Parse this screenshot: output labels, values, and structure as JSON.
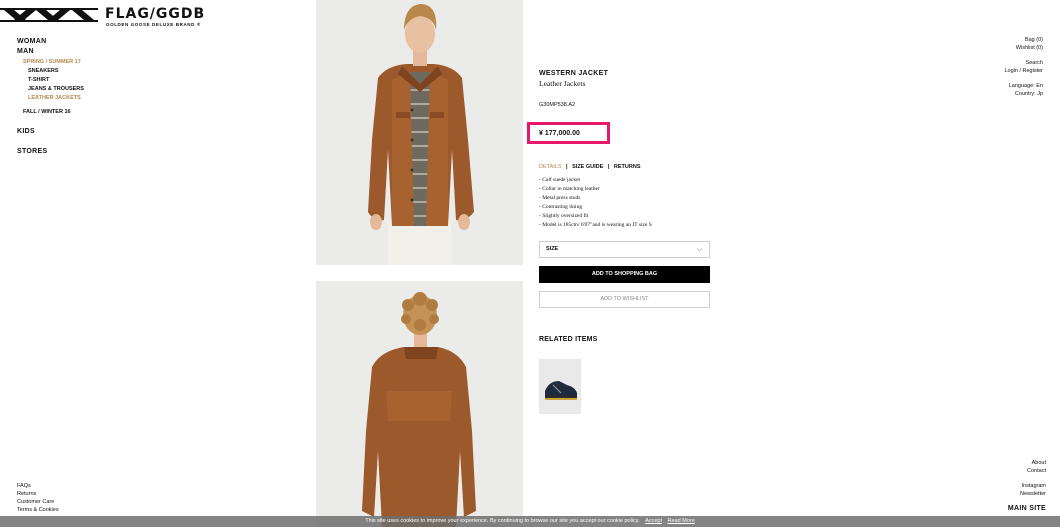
{
  "brand": {
    "wordmark": "FLAG/GGDB",
    "subline": "GOLDEN GOOSE DELUXE BRAND ®"
  },
  "left_nav": {
    "woman": "WOMAN",
    "man": "MAN",
    "seasons": [
      {
        "label": "SPRING / SUMMER 17",
        "active": true,
        "items": [
          {
            "label": "SNEAKERS",
            "active": false
          },
          {
            "label": "T-SHIRT",
            "active": false
          },
          {
            "label": "JEANS & TROUSERS",
            "active": false
          },
          {
            "label": "LEATHER JACKETS",
            "active": true
          }
        ]
      },
      {
        "label": "FALL / WINTER 16",
        "active": false,
        "items": []
      }
    ],
    "kids": "KIDS",
    "stores": "STORES"
  },
  "left_footer": [
    "FAQs",
    "Returns",
    "Customer Care",
    "Terms & Cookies"
  ],
  "right_nav": {
    "bag": "Bag (0)",
    "wishlist": "Wishlist (0)",
    "search": "Search",
    "login": "Login / Register",
    "language": "Language: En",
    "country": "Country: Jp"
  },
  "right_footer": {
    "about": "About",
    "contact": "Contact",
    "instagram": "Instagram",
    "newsletter": "Newsletter",
    "main_site": "MAIN SITE"
  },
  "product": {
    "name": "WESTERN JACKET",
    "category": "Leather Jackets",
    "code": "G30MP538.A2",
    "price": "¥ 177,000.00",
    "tabs": {
      "details": "DETAILS",
      "size_guide": "SIZE GUIDE",
      "returns": "RETURNS",
      "separator": "|"
    },
    "bullets": [
      "- Calf suede jacket",
      "- Collar in matching leather",
      "- Metal press studs",
      "- Contrasting lining",
      "- Slightly oversized fit",
      "- Model is 185cm/ 6'07\"and is wearing an IT size S"
    ],
    "size_label": "SIZE",
    "size_chevron": "⌵",
    "add_to_bag": "ADD TO SHOPPING BAG",
    "add_to_wishlist": "ADD TO WISHLIST",
    "related_title": "RELATED ITEMS"
  },
  "cookie_bar": {
    "text": "This site uses cookies to improve your experience. By continuing to browse our site you accept our cookie policy.",
    "accept": "Accept",
    "read_more": "Read More"
  },
  "colors": {
    "accent_gold": "#b38a4e",
    "highlight_pink": "#e8196b",
    "button_black": "#000000"
  }
}
